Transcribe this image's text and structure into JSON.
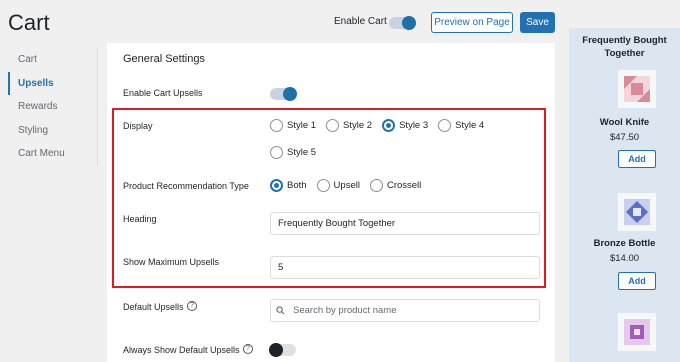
{
  "header": {
    "title": "Cart",
    "enable_cart_label": "Enable Cart",
    "enable_cart_on": true,
    "preview_label": "Preview on Page",
    "save_label": "Save"
  },
  "sidebar": {
    "items": [
      {
        "label": "Cart",
        "active": false
      },
      {
        "label": "Upsells",
        "active": true
      },
      {
        "label": "Rewards",
        "active": false
      },
      {
        "label": "Styling",
        "active": false
      },
      {
        "label": "Cart Menu",
        "active": false
      }
    ]
  },
  "settings": {
    "section_title": "General Settings",
    "enable_upsells_label": "Enable Cart Upsells",
    "enable_upsells_on": true,
    "display_label": "Display",
    "display_options": [
      "Style 1",
      "Style 2",
      "Style 3",
      "Style 4",
      "Style 5"
    ],
    "display_selected": "Style 3",
    "recommendation_label": "Product Recommendation Type",
    "recommendation_options": [
      "Both",
      "Upsell",
      "Crossell"
    ],
    "recommendation_selected": "Both",
    "heading_label": "Heading",
    "heading_value": "Frequently Bought Together",
    "max_upsells_label": "Show Maximum Upsells",
    "max_upsells_value": "5",
    "default_upsells_label": "Default Upsells",
    "search_placeholder": "Search by product name",
    "always_show_label": "Always Show Default Upsells",
    "always_show_on": false
  },
  "preview": {
    "title": "Frequently Bought Together",
    "products": [
      {
        "name": "Wool Knife",
        "price": "$47.50",
        "button": "Add",
        "icon_color": "#d98a9a"
      },
      {
        "name": "Bronze Bottle",
        "price": "$14.00",
        "button": "Add",
        "icon_color": "#5b6fc4"
      },
      {
        "name": "",
        "price": "",
        "button": "",
        "icon_color": "#a45bb8"
      }
    ]
  },
  "colors": {
    "accent": "#2271b1",
    "highlight": "#e01b24",
    "preview_bg": "#dbe6f0"
  }
}
